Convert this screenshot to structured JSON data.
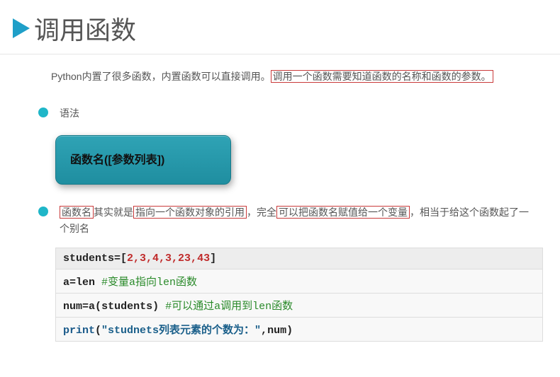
{
  "title": "调用函数",
  "intro": {
    "pre": "Python内置了很多函数，内置函数可以直接调用。",
    "boxed": "调用一个函数需要知道函数的名称和函数的参数。"
  },
  "bullet1": "语法",
  "syntax": "函数名([参数列表])",
  "bullet2": {
    "seg1_boxed": "函数名",
    "seg2": "其实就是",
    "seg3_boxed": "指向一个函数对象的引用",
    "seg4": "，完全",
    "seg5_boxed": "可以把函数名赋值给一个变量",
    "seg6": "，相当于给这个函数起了一个别名"
  },
  "code": {
    "l1": {
      "a": "students",
      "eq": "=",
      "lb": "[",
      "n": "2,3,4,3,23,43",
      "rb": "]"
    },
    "l2": {
      "a": "a",
      "eq": "=",
      "b": "len",
      "cmt": "  #变量a指向len函数"
    },
    "l3": {
      "a": "num",
      "eq": "=",
      "b": "a",
      "lp": "(",
      "c": "students",
      "rp": ")",
      "cmt": "  #可以通过a调用到len函数"
    },
    "l4": {
      "fn": "print",
      "lp": "(",
      "str": "\"studnets列表元素的个数为：\"",
      "comma": ",",
      "c": "num",
      "rp": ")"
    }
  }
}
